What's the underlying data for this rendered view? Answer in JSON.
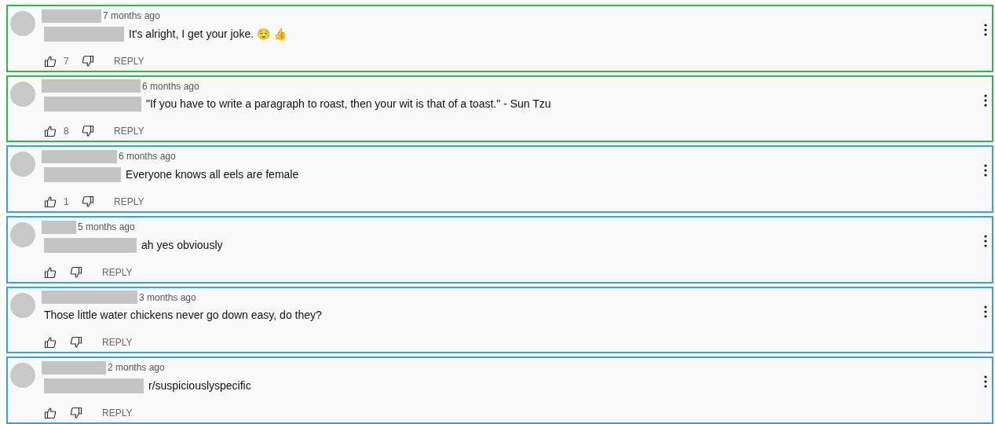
{
  "comments": [
    {
      "time": "7 months ago",
      "text": "It's alright, I get your joke. 😌 👍",
      "likes": "7",
      "reply": "REPLY",
      "color": "#2eb84b"
    },
    {
      "time": "6 months ago",
      "text": "\"If you have to write a paragraph to roast, then your wit is that of a toast.\" - Sun Tzu",
      "likes": "8",
      "reply": "REPLY",
      "color": "#2eb84b"
    },
    {
      "time": "6 months ago",
      "text": "Everyone knows all eels are female",
      "likes": "1",
      "reply": "REPLY",
      "color": "#36a3dc"
    },
    {
      "time": "5 months ago",
      "text": "ah yes obviously",
      "reply": "REPLY",
      "color": "#36a3dc"
    },
    {
      "time": "3 months ago",
      "text": "Those little water chickens never go down easy, do they?",
      "reply": "REPLY",
      "color": "#36a3dc"
    },
    {
      "time": "2 months ago",
      "text": "r/suspiciouslyspecific",
      "reply": "REPLY",
      "color": "#36a3dc"
    }
  ]
}
